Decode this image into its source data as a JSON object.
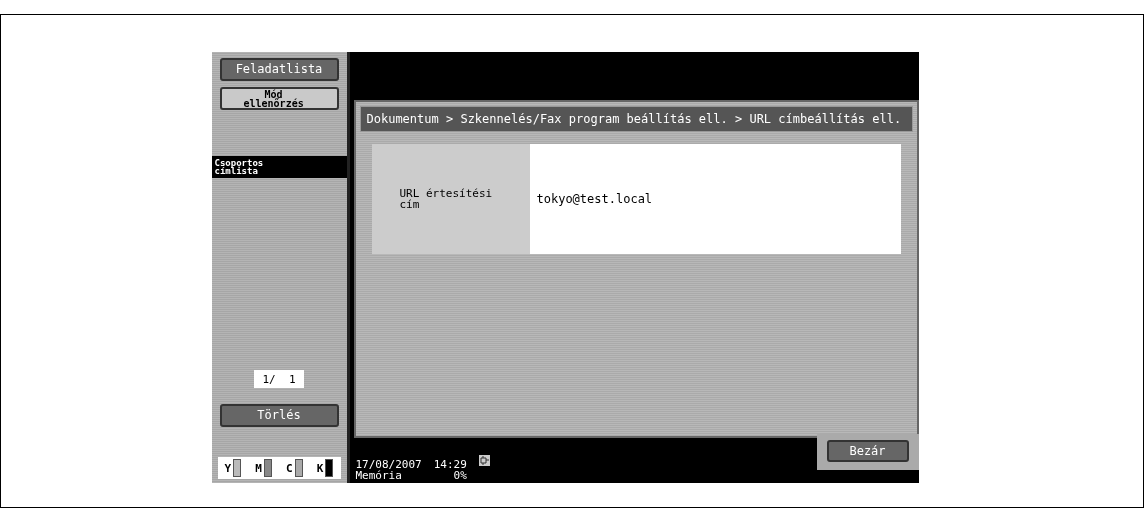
{
  "sidebar": {
    "buttons": [
      {
        "label": "Feladatlista",
        "kind": "dark"
      },
      {
        "label": "Mód\nellenőrzés",
        "kind": "light"
      }
    ],
    "tab": {
      "label": "Csoportos\ncímlista",
      "selected": true
    },
    "page_counter": "1/  1",
    "delete_button": "Törlés",
    "toner": [
      {
        "label": "Y",
        "level": 1
      },
      {
        "label": "M",
        "level": 1
      },
      {
        "label": "C",
        "level": 1
      },
      {
        "label": "K",
        "level": 1
      }
    ]
  },
  "breadcrumb": "Dokumentum > Szkennelés/Fax program beállítás ell. > URL címbeállítás ell.",
  "field": {
    "label": "URL értesítési\ncím",
    "value": "tokyo@test.local"
  },
  "status_bar": {
    "date": "17/08/2007",
    "time": "14:29",
    "memory_label": "Memória",
    "memory_value": "0%"
  },
  "close_button": "Bezár"
}
